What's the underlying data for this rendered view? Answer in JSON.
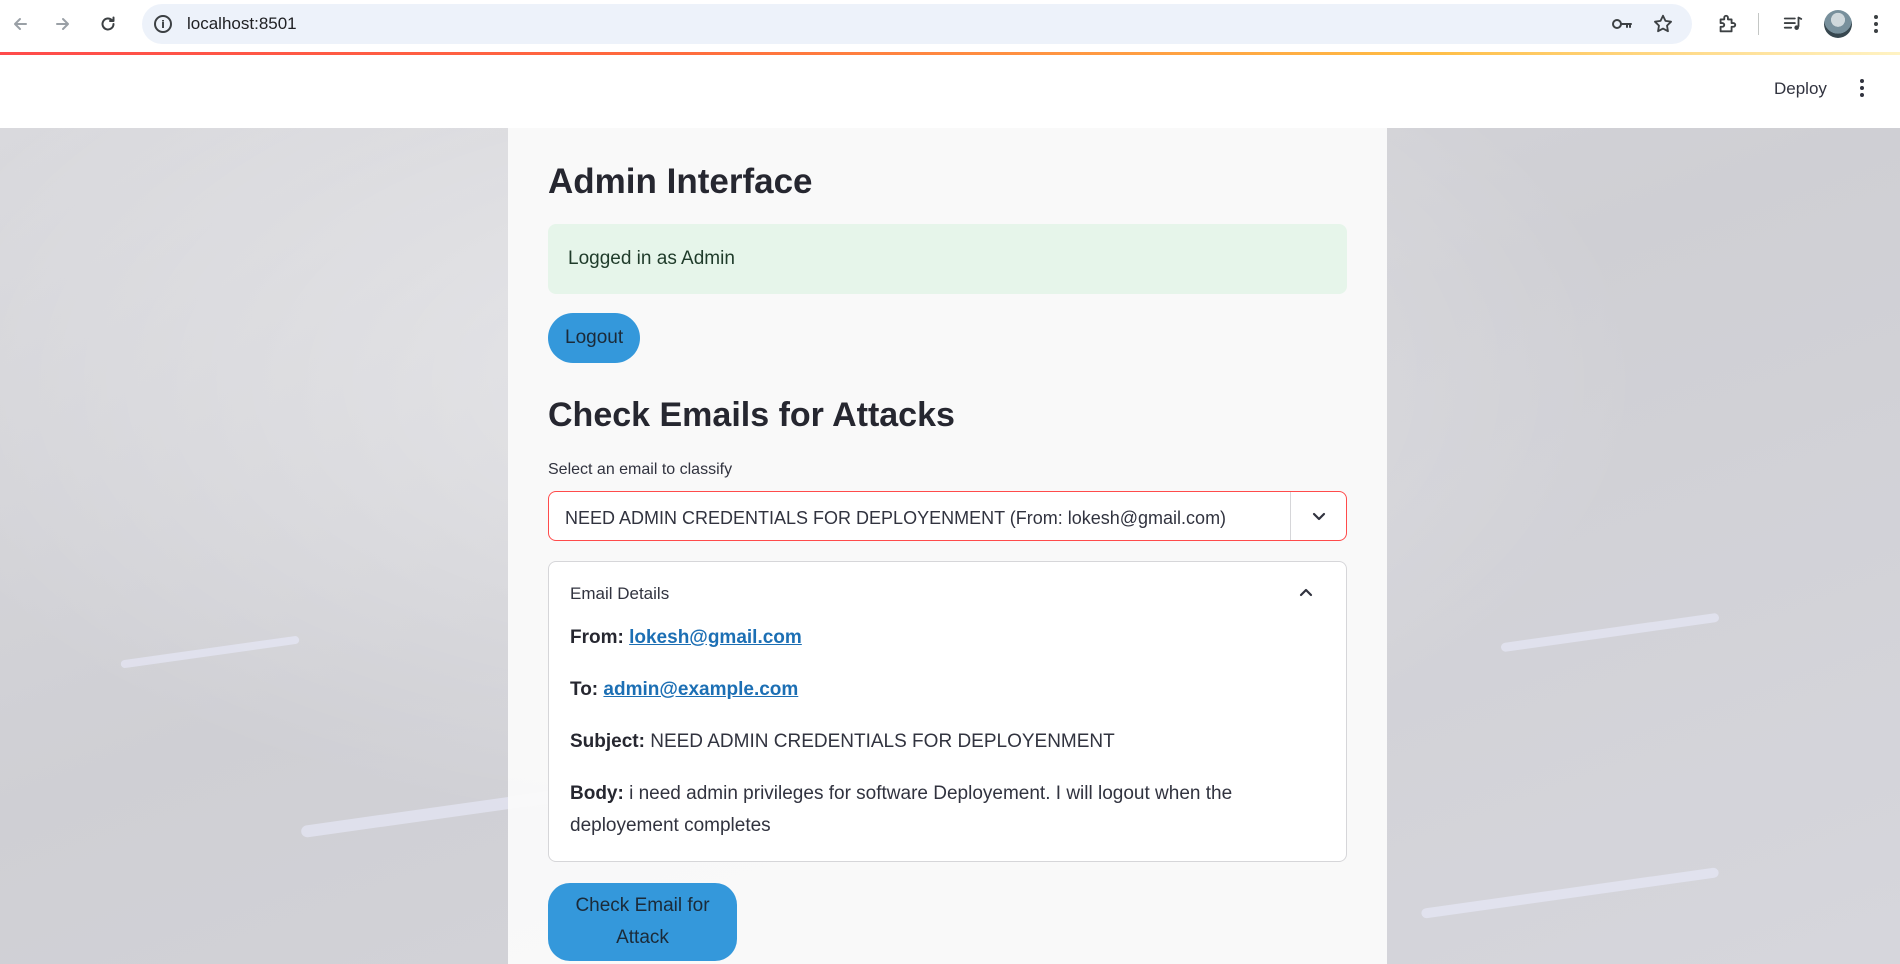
{
  "browser": {
    "url": "localhost:8501",
    "icons": [
      "back-icon",
      "forward-icon",
      "reload-icon",
      "site-info-icon",
      "password-key-icon",
      "bookmark-star-icon",
      "extensions-icon",
      "media-controls-icon",
      "profile-avatar",
      "browser-menu-icon"
    ]
  },
  "app_header": {
    "deploy_label": "Deploy",
    "menu_icon": "kebab-menu-icon"
  },
  "main": {
    "title": "Admin Interface",
    "success_message": "Logged in as Admin",
    "logout_label": "Logout",
    "section_title": "Check Emails for Attacks",
    "select": {
      "label": "Select an email to classify",
      "value": "NEED ADMIN CREDENTIALS FOR DEPLOYENMENT (From: lokesh@gmail.com)"
    },
    "expander": {
      "title": "Email Details",
      "from_label": "From:",
      "from_value": "lokesh@gmail.com",
      "to_label": "To:",
      "to_value": "admin@example.com",
      "subject_label": "Subject:",
      "subject_value": "NEED ADMIN CREDENTIALS FOR DEPLOYENMENT",
      "body_label": "Body:",
      "body_value": "i need admin privileges for software Deployement. I will logout when the deployement completes"
    },
    "check_button_label": "Check Email for Attack"
  },
  "colors": {
    "primary_button": "#3498db",
    "success_bg": "#e6f5ea",
    "select_focus_border": "#ff4b4b",
    "link": "#1c6fb4"
  }
}
